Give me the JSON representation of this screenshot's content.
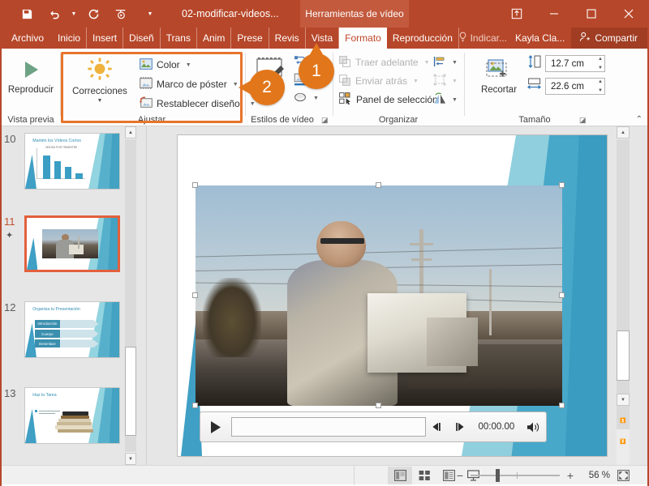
{
  "titlebar": {
    "quick_access": [
      {
        "name": "save-icon",
        "label": "Guardar"
      },
      {
        "name": "undo-icon",
        "label": "Deshacer"
      },
      {
        "name": "redo-icon",
        "label": "Rehacer"
      },
      {
        "name": "start-slideshow-icon",
        "label": "Comenzar presentación"
      },
      {
        "name": "customize-qat-icon",
        "label": "Personalizar"
      }
    ],
    "document_title": "02-modificar-videos...",
    "contextual_tab_label": "Herramientas de vídeo",
    "window_controls": [
      {
        "name": "ribbon-display-options-icon",
        "glyph": "ribbon"
      },
      {
        "name": "minimize-icon",
        "glyph": "minimize"
      },
      {
        "name": "maximize-icon",
        "glyph": "maximize"
      },
      {
        "name": "close-icon",
        "glyph": "close"
      }
    ]
  },
  "tabs": [
    {
      "label": "Archivo",
      "active": false
    },
    {
      "label": "Inicio",
      "active": false
    },
    {
      "label": "Insert",
      "active": false
    },
    {
      "label": "Diseñ",
      "active": false
    },
    {
      "label": "Trans",
      "active": false
    },
    {
      "label": "Anim",
      "active": false
    },
    {
      "label": "Prese",
      "active": false
    },
    {
      "label": "Revis",
      "active": false
    },
    {
      "label": "Vista",
      "active": false
    },
    {
      "label": "Formato",
      "active": true
    },
    {
      "label": "Reproducción",
      "active": false
    }
  ],
  "tab_right": {
    "tell_me": "Indicar...",
    "account": "Kayla Cla...",
    "share": "Compartir"
  },
  "ribbon": {
    "groups": [
      {
        "name": "vista-previa",
        "label": "Vista previa",
        "buttons": [
          {
            "label": "Reproducir",
            "name": "play-button"
          }
        ]
      },
      {
        "name": "ajustar",
        "label": "Ajustar",
        "highlighted": true,
        "buttons": [
          {
            "label": "Correcciones",
            "name": "corrections-button"
          },
          {
            "label": "Color",
            "name": "color-button"
          },
          {
            "label": "Marco de póster",
            "name": "poster-frame-button"
          },
          {
            "label": "Restablecer diseño",
            "name": "reset-design-button"
          }
        ]
      },
      {
        "name": "estilos-de-video",
        "label": "Estilos de vídeo",
        "buttons": [
          {
            "label": "vídeo",
            "name": "video-styles-button"
          },
          {
            "label": "Forma de vídeo",
            "name": "video-shape-button"
          },
          {
            "label": "Borde de vídeo",
            "name": "video-border-button"
          },
          {
            "label": "Efectos de vídeo",
            "name": "video-effects-button"
          }
        ]
      },
      {
        "name": "organizar",
        "label": "Organizar",
        "buttons": [
          {
            "label": "Traer adelante",
            "name": "bring-forward-button",
            "disabled": true
          },
          {
            "label": "Enviar atrás",
            "name": "send-backward-button",
            "disabled": true
          },
          {
            "label": "Panel de selección",
            "name": "selection-pane-button",
            "disabled": false
          },
          {
            "label": "Alinear",
            "name": "align-button"
          },
          {
            "label": "Agrupar",
            "name": "group-button"
          },
          {
            "label": "Girar",
            "name": "rotate-button"
          }
        ]
      },
      {
        "name": "tamano",
        "label": "Tamaño",
        "buttons": [
          {
            "label": "Recortar",
            "name": "crop-button"
          }
        ],
        "height_value": "12.7 cm",
        "width_value": "22.6 cm"
      }
    ]
  },
  "callouts": [
    {
      "number": "1",
      "name": "callout-badge-1",
      "points": "up",
      "target": "formato-tab"
    },
    {
      "number": "2",
      "name": "callout-badge-2",
      "points": "left",
      "target": "ajustar-group"
    }
  ],
  "thumbnails": [
    {
      "number": "10",
      "name": "slide-thumbnail-10",
      "selected": false,
      "kind": "chart",
      "title": "Mantén los Vídeos Cortos",
      "chart_title": "VENTAS POR TRIMESTRE",
      "bars": [
        78,
        58,
        38,
        18
      ]
    },
    {
      "number": "11",
      "name": "slide-thumbnail-11",
      "selected": true,
      "kind": "photo",
      "title": "",
      "has_animation_star": true
    },
    {
      "number": "12",
      "name": "slide-thumbnail-12",
      "selected": false,
      "kind": "process",
      "title": "Organiza tu Presentación",
      "steps": [
        "Introducción",
        "Cuerpo",
        "Desenlace"
      ]
    },
    {
      "number": "13",
      "name": "slide-thumbnail-13",
      "selected": false,
      "kind": "books",
      "title": "Haz tu Tarea"
    }
  ],
  "video_player": {
    "name": "video-playback-bar",
    "time": "00:00.00",
    "play_label": "Reproducir",
    "prev_frame_label": "Fotograma anterior",
    "next_frame_label": "Fotograma siguiente",
    "volume_label": "Volumen"
  },
  "statusbar": {
    "views": [
      {
        "name": "view-normal",
        "active": true
      },
      {
        "name": "view-slide-sorter",
        "active": false
      },
      {
        "name": "view-reading",
        "active": false
      },
      {
        "name": "view-slideshow",
        "active": false
      }
    ],
    "zoom_out_label": "−",
    "zoom_in_label": "+",
    "zoom_percent": "56 %",
    "fit_label": "Ajustar a la ventana"
  },
  "colors": {
    "ribbon_accent": "#b7472a",
    "highlight": "#e8742c",
    "badge": "#e2761b",
    "selection": "#e2603c",
    "slide_teal": "#48a8c9"
  }
}
